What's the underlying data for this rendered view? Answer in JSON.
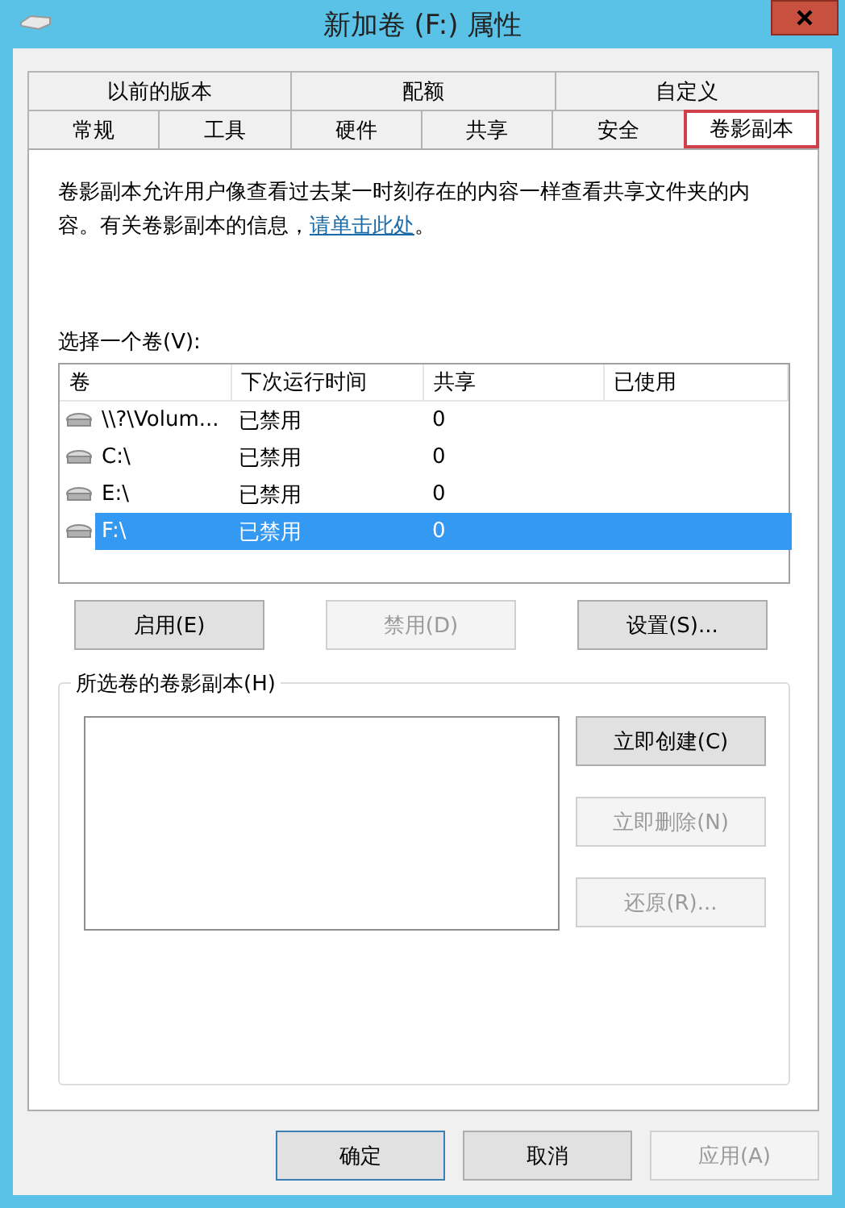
{
  "window": {
    "title": "新加卷 (F:) 属性"
  },
  "tabs": [
    [
      {
        "label": "以前的版本",
        "selected": false
      },
      {
        "label": "配额",
        "selected": false
      },
      {
        "label": "自定义",
        "selected": false
      }
    ],
    [
      {
        "label": "常规",
        "selected": false
      },
      {
        "label": "工具",
        "selected": false
      },
      {
        "label": "硬件",
        "selected": false
      },
      {
        "label": "共享",
        "selected": false
      },
      {
        "label": "安全",
        "selected": false
      },
      {
        "label": "卷影副本",
        "selected": true
      }
    ]
  ],
  "description": {
    "text": "卷影副本允许用户像查看过去某一时刻存在的内容一样查看共享文件夹的内容。有关卷影副本的信息，",
    "link": "请单击此处",
    "after": "。"
  },
  "volume_label": "选择一个卷(V):",
  "table": {
    "columns": [
      "卷",
      "下次运行时间",
      "共享",
      "已使用"
    ],
    "rows": [
      {
        "cells": [
          "\\\\?\\Volum...",
          "已禁用",
          "0",
          ""
        ],
        "selected": false
      },
      {
        "cells": [
          "C:\\",
          "已禁用",
          "0",
          ""
        ],
        "selected": false
      },
      {
        "cells": [
          "E:\\",
          "已禁用",
          "0",
          ""
        ],
        "selected": false
      },
      {
        "cells": [
          "F:\\",
          "已禁用",
          "0",
          ""
        ],
        "selected": true
      }
    ]
  },
  "volume_buttons": [
    {
      "label": "启用(E)",
      "disabled": false
    },
    {
      "label": "禁用(D)",
      "disabled": true
    },
    {
      "label": "设置(S)...",
      "disabled": false
    }
  ],
  "group": {
    "title": "所选卷的卷影副本(H)",
    "buttons": [
      {
        "label": "立即创建(C)",
        "disabled": false
      },
      {
        "label": "立即删除(N)",
        "disabled": true
      },
      {
        "label": "还原(R)...",
        "disabled": true
      }
    ]
  },
  "dialog_buttons": [
    {
      "label": "确定",
      "disabled": false,
      "default": true
    },
    {
      "label": "取消",
      "disabled": false,
      "default": false
    },
    {
      "label": "应用(A)",
      "disabled": true,
      "default": false
    }
  ]
}
